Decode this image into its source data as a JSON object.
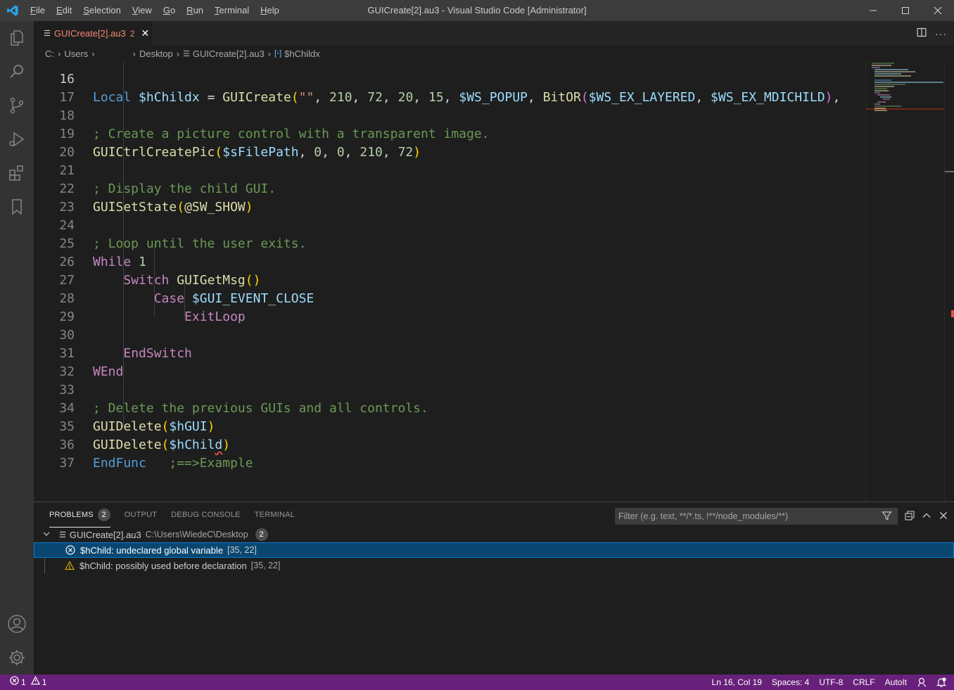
{
  "window": {
    "title": "GUICreate[2].au3 - Visual Studio Code [Administrator]",
    "menu": [
      {
        "pre": "",
        "key": "F",
        "rest": "ile"
      },
      {
        "pre": "",
        "key": "E",
        "rest": "dit"
      },
      {
        "pre": "",
        "key": "S",
        "rest": "election"
      },
      {
        "pre": "",
        "key": "V",
        "rest": "iew"
      },
      {
        "pre": "",
        "key": "G",
        "rest": "o"
      },
      {
        "pre": "",
        "key": "R",
        "rest": "un"
      },
      {
        "pre": "",
        "key": "T",
        "rest": "erminal"
      },
      {
        "pre": "",
        "key": "H",
        "rest": "elp"
      }
    ]
  },
  "tab": {
    "name": "GUICreate[2].au3",
    "problem_count": "2",
    "close_glyph": "✕"
  },
  "breadcrumb": {
    "drive": "C:",
    "users": "Users",
    "desktop": "Desktop",
    "file": "GUICreate[2].au3",
    "symbol": "$hChildx"
  },
  "editor": {
    "line_numbers": [
      "16",
      "17",
      "18",
      "19",
      "20",
      "21",
      "22",
      "23",
      "24",
      "25",
      "26",
      "27",
      "28",
      "29",
      "30",
      "31",
      "32",
      "33",
      "34",
      "35",
      "36",
      "37"
    ],
    "active_line": "16"
  },
  "panel": {
    "tabs": {
      "problems": "PROBLEMS",
      "problems_count": "2",
      "output": "OUTPUT",
      "debug_console": "DEBUG CONSOLE",
      "terminal": "TERMINAL"
    },
    "filter_placeholder": "Filter (e.g. text, **/*.ts, !**/node_modules/**)",
    "file_group": {
      "name": "GUICreate[2].au3",
      "path": "C:\\Users\\WiedeC\\Desktop",
      "count": "2"
    },
    "problems": [
      {
        "severity": "error",
        "message": "$hChild: undeclared global variable",
        "position": "[35, 22]"
      },
      {
        "severity": "warning",
        "message": "$hChild: possibly used before declaration",
        "position": "[35, 22]"
      }
    ]
  },
  "statusbar": {
    "errors": "1",
    "warnings": "1",
    "cursor": "Ln 16, Col 19",
    "spaces": "Spaces: 4",
    "encoding": "UTF-8",
    "eol": "CRLF",
    "language": "AutoIt"
  },
  "colors": {
    "statusbar_bg": "#68217a",
    "error": "#f14c4c",
    "warning": "#cca700",
    "accent": "#007acc"
  }
}
